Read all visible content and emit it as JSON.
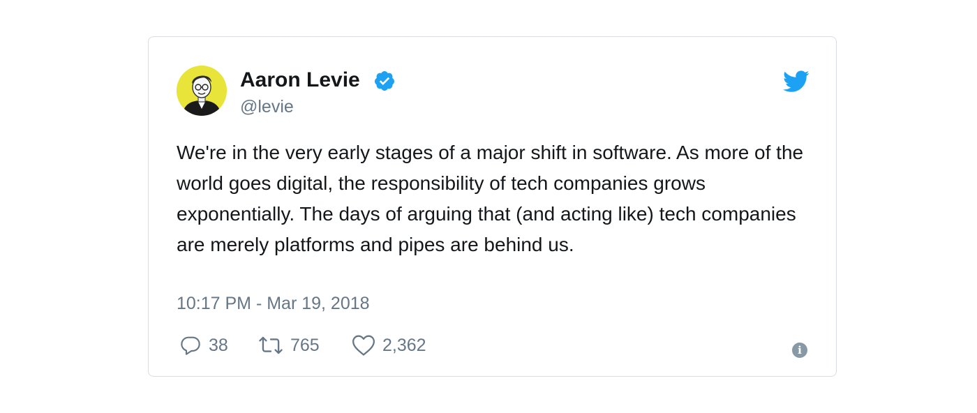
{
  "author": {
    "name": "Aaron Levie",
    "handle": "@levie",
    "verified": true,
    "avatar_icon": "avatar-illustration",
    "avatar_bg": "#e8e43a"
  },
  "tweet": {
    "text": "We're in the very early stages of a major shift in software. As more of the world goes digital, the responsibility of tech companies grows exponentially. The days of arguing that (and acting like) tech companies are merely platforms and pipes are behind us.",
    "timestamp": "10:17 PM - Mar 19, 2018"
  },
  "actions": {
    "replies": "38",
    "retweets": "765",
    "likes": "2,362"
  },
  "icons": {
    "brand": "twitter-bird-icon",
    "verified": "verified-badge-icon",
    "reply": "reply-icon",
    "retweet": "retweet-icon",
    "like": "heart-icon",
    "info": "info-icon"
  },
  "colors": {
    "brand_blue": "#1da1f2",
    "text": "#14171a",
    "secondary_text": "#657786",
    "border": "#d9dde1",
    "info_grey": "#8899a6"
  }
}
